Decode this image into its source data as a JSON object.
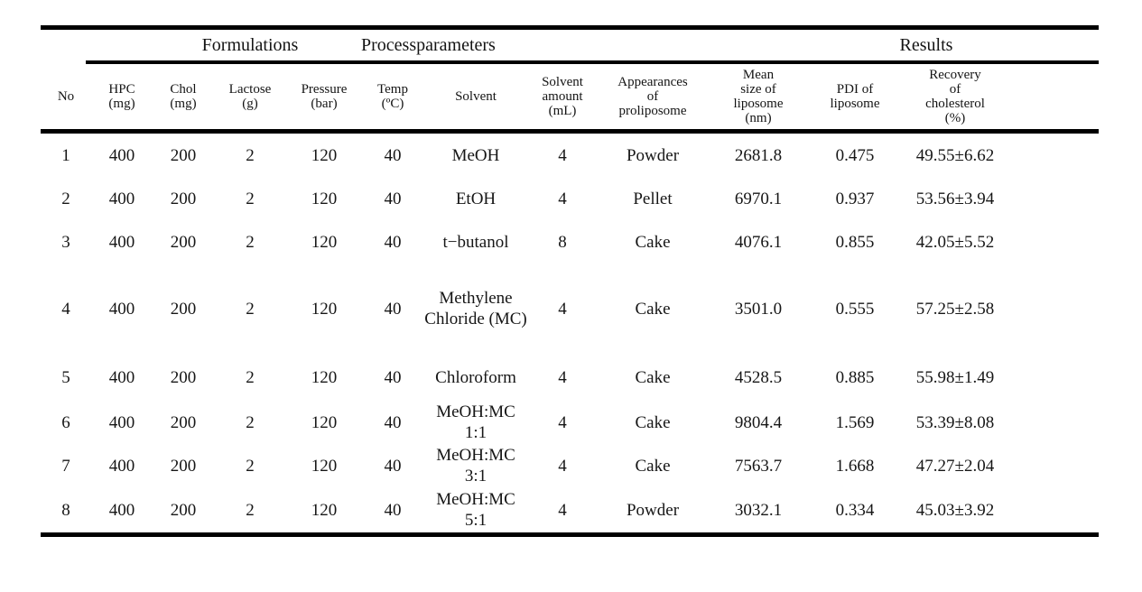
{
  "table": {
    "group_headers": [
      {
        "label": "Formulations"
      },
      {
        "label": "Process parameters"
      },
      {
        "label": "Results"
      }
    ],
    "group_process_word1": "Process",
    "group_process_word2": "parameters",
    "columns": [
      {
        "lines": [
          "No"
        ]
      },
      {
        "lines": [
          "HPC",
          "(mg)"
        ]
      },
      {
        "lines": [
          "Chol",
          "(mg)"
        ]
      },
      {
        "lines": [
          "Lactose",
          "(g)"
        ]
      },
      {
        "lines": [
          "Pressure",
          "(bar)"
        ]
      },
      {
        "lines": [
          "Temp",
          "(ºC)"
        ]
      },
      {
        "lines": [
          "Solvent"
        ]
      },
      {
        "lines": [
          "Solvent",
          "amount",
          "(mL)"
        ]
      },
      {
        "lines": [
          "Appearances",
          "of",
          "proliposome"
        ]
      },
      {
        "lines": [
          "Mean",
          "size of",
          "liposome",
          "(nm)"
        ]
      },
      {
        "lines": [
          "PDI of",
          "liposome"
        ]
      },
      {
        "lines": [
          "Recovery",
          "of",
          "cholesterol",
          "(%)"
        ]
      }
    ],
    "rows": [
      {
        "no": "1",
        "hpc": "400",
        "chol": "200",
        "lactose": "2",
        "pressure": "120",
        "temp": "40",
        "solvent": "MeOH",
        "solvent_amount": "4",
        "appearance": "Powder",
        "mean_size": "2681.8",
        "pdi": "0.475",
        "recovery": "49.55±6.62"
      },
      {
        "no": "2",
        "hpc": "400",
        "chol": "200",
        "lactose": "2",
        "pressure": "120",
        "temp": "40",
        "solvent": "EtOH",
        "solvent_amount": "4",
        "appearance": "Pellet",
        "mean_size": "6970.1",
        "pdi": "0.937",
        "recovery": "53.56±3.94"
      },
      {
        "no": "3",
        "hpc": "400",
        "chol": "200",
        "lactose": "2",
        "pressure": "120",
        "temp": "40",
        "solvent": "t−butanol",
        "solvent_amount": "8",
        "appearance": "Cake",
        "mean_size": "4076.1",
        "pdi": "0.855",
        "recovery": "42.05±5.52"
      },
      {
        "no": "4",
        "hpc": "400",
        "chol": "200",
        "lactose": "2",
        "pressure": "120",
        "temp": "40",
        "solvent": "Methylene Chloride (MC)",
        "solvent_amount": "4",
        "appearance": "Cake",
        "mean_size": "3501.0",
        "pdi": "0.555",
        "recovery": "57.25±2.58"
      },
      {
        "no": "5",
        "hpc": "400",
        "chol": "200",
        "lactose": "2",
        "pressure": "120",
        "temp": "40",
        "solvent": "Chloroform",
        "solvent_amount": "4",
        "appearance": "Cake",
        "mean_size": "4528.5",
        "pdi": "0.885",
        "recovery": "55.98±1.49"
      },
      {
        "no": "6",
        "hpc": "400",
        "chol": "200",
        "lactose": "2",
        "pressure": "120",
        "temp": "40",
        "solvent": "MeOH:MC 1:1",
        "solvent_amount": "4",
        "appearance": "Cake",
        "mean_size": "9804.4",
        "pdi": "1.569",
        "recovery": "53.39±8.08"
      },
      {
        "no": "7",
        "hpc": "400",
        "chol": "200",
        "lactose": "2",
        "pressure": "120",
        "temp": "40",
        "solvent": "MeOH:MC 3:1",
        "solvent_amount": "4",
        "appearance": "Cake",
        "mean_size": "7563.7",
        "pdi": "1.668",
        "recovery": "47.27±2.04"
      },
      {
        "no": "8",
        "hpc": "400",
        "chol": "200",
        "lactose": "2",
        "pressure": "120",
        "temp": "40",
        "solvent": "MeOH:MC 5:1",
        "solvent_amount": "4",
        "appearance": "Powder",
        "mean_size": "3032.1",
        "pdi": "0.334",
        "recovery": "45.03±3.92"
      }
    ]
  }
}
